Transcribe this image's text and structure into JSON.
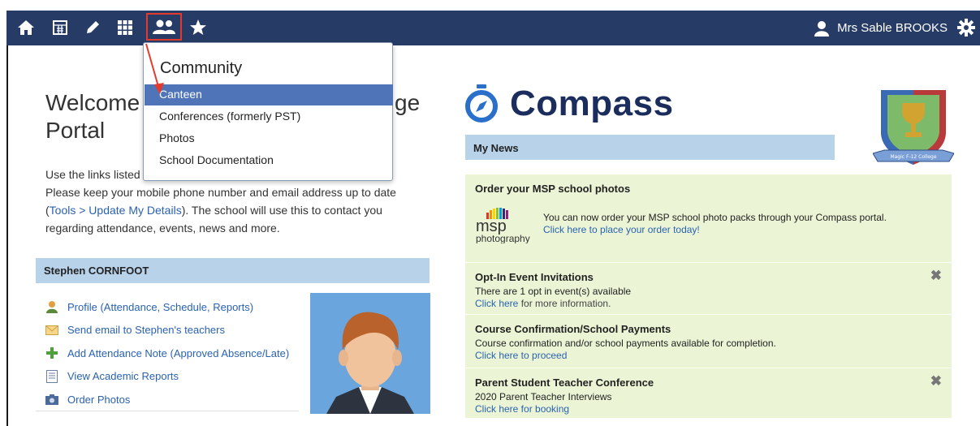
{
  "topbar": {
    "icons": [
      "home-icon",
      "calendar-icon",
      "pencil-icon",
      "grid-icon",
      "community-icon",
      "star-icon"
    ],
    "user_name": "Mrs Sable BROOKS",
    "bg_color": "#263c66",
    "highlight_color": "#e23b2e"
  },
  "dropdown": {
    "title": "Community",
    "items": [
      {
        "label": "Canteen"
      },
      {
        "label": "Conferences (formerly PST)"
      },
      {
        "label": "Photos"
      },
      {
        "label": "School Documentation"
      }
    ]
  },
  "welcome": {
    "line1": "Welcome",
    "line1_suffix": "ge",
    "line2": "Portal",
    "intro_line1": "Use the links listed",
    "intro_line2": "Please keep your mobile phone number and email address up to date",
    "intro_link": "Tools > Update My Details",
    "intro_line3_pre": "(",
    "intro_line3_post": "). The school will use this to contact you",
    "intro_line4": "regarding attendance, events, news and more."
  },
  "student": {
    "name": "Stephen CORNFOOT",
    "links": [
      {
        "label": "Profile (Attendance, Schedule, Reports)",
        "icon": "profile-icon"
      },
      {
        "label": "Send email to Stephen's teachers",
        "icon": "email-icon"
      },
      {
        "label": "Add Attendance Note (Approved Absence/Late)",
        "icon": "plus-icon"
      },
      {
        "label": "View Academic Reports",
        "icon": "report-icon"
      },
      {
        "label": "Order Photos",
        "icon": "camera-icon"
      }
    ]
  },
  "compass": {
    "brand": "Compass",
    "school_banner": "Magic F-12 College"
  },
  "news": {
    "header": "My News",
    "items": [
      {
        "title": "Order your MSP school photos",
        "logo_main": "msp",
        "logo_sub": "photography",
        "body": "You can now order your MSP school photo packs through your Compass portal.",
        "link": "Click here to place your order today!"
      },
      {
        "title": "Opt-In Event Invitations",
        "body": "There are 1 opt in event(s) available",
        "link": "Click here",
        "after": " for more information."
      },
      {
        "title": "Course Confirmation/School Payments",
        "body": "Course confirmation and/or school payments available for completion.",
        "link": "Click here to proceed"
      },
      {
        "title": "Parent Student Teacher Conference",
        "body": "2020 Parent Teacher Interviews",
        "link": "Click here for booking"
      }
    ]
  }
}
